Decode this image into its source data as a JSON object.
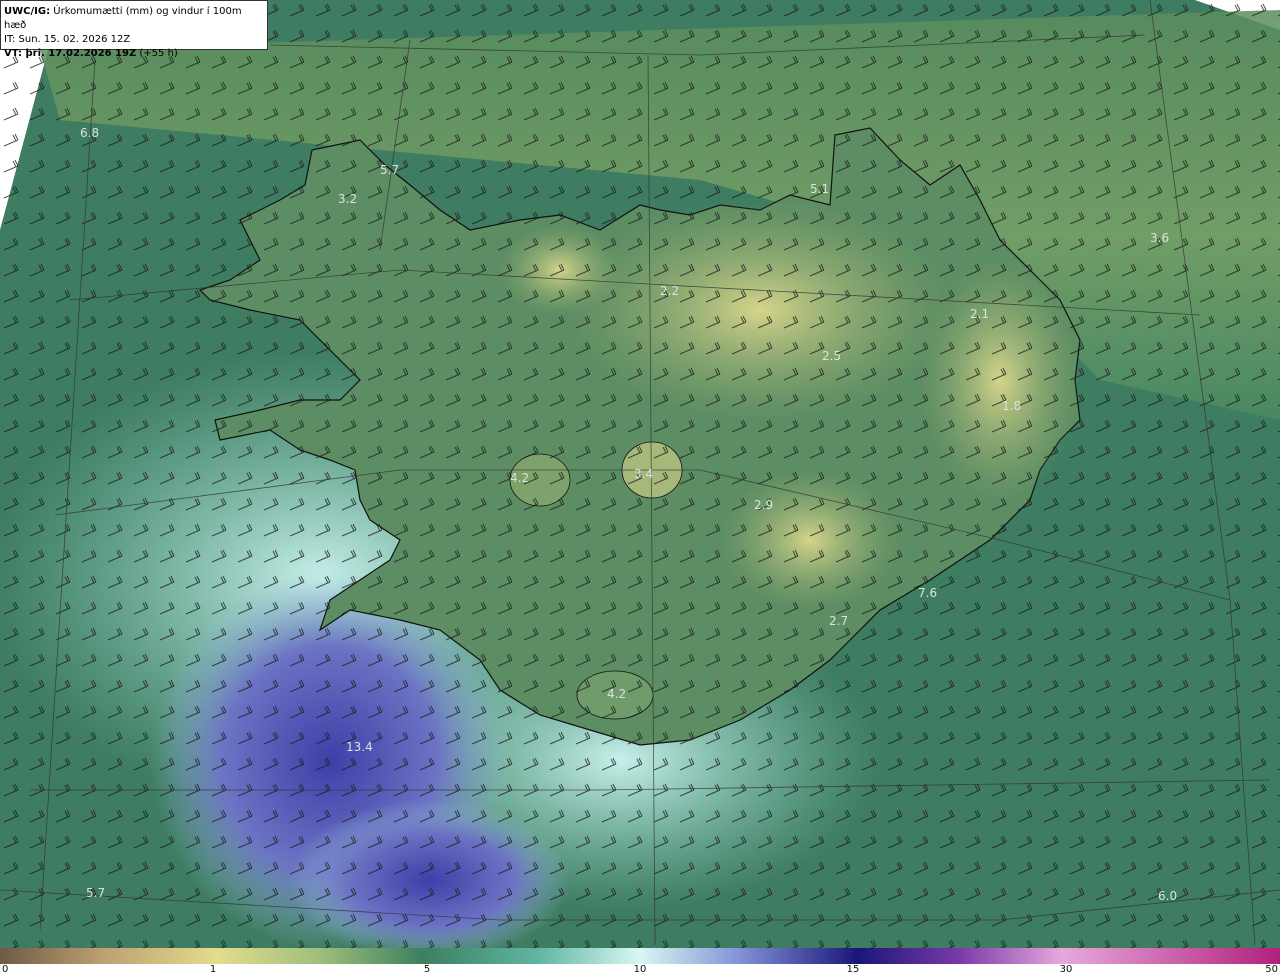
{
  "header": {
    "line1_bold": "UWC/IG:",
    "line1_rest": "Úrkomumætti (mm) og vindur í 100m hæð",
    "line2": "IT: Sun. 15. 02. 2026 12Z",
    "line3_bold": "VT: þri. 17.02.2026 19Z",
    "line3_rest": "(+55 h)"
  },
  "map_labels": [
    "6.8",
    "5.7",
    "3.2",
    "5.1",
    "3.6",
    "2.2",
    "2.1",
    "2.5",
    "1.8",
    "4.2",
    "3.4",
    "2.9",
    "7.6",
    "2.7",
    "4.2",
    "13.4",
    "5.7",
    "6.0"
  ],
  "colorbar": {
    "ticks": [
      "0",
      "1",
      "5",
      "10",
      "15",
      "30",
      "50"
    ],
    "unit": "mm"
  },
  "colors": {
    "ocean": "#3f7e61",
    "land_low": "#5f8f64",
    "land_high": "#b8c482",
    "north_band": "#6f9a68",
    "south_light": "#a6e3dc",
    "south_blue": "#5b5fb8",
    "coast": "#111111"
  }
}
